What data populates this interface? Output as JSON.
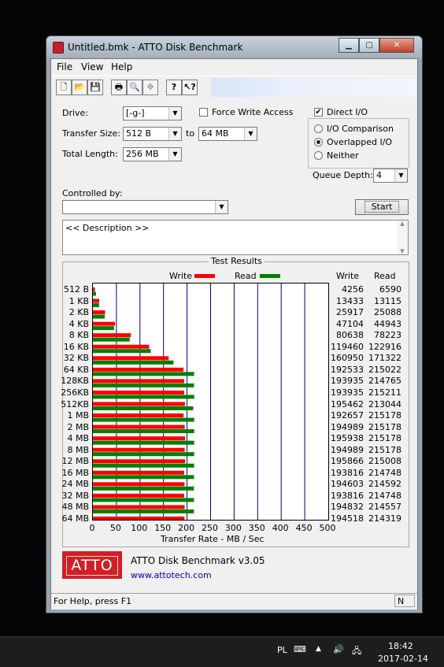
{
  "window": {
    "title": "Untitled.bmk - ATTO Disk Benchmark"
  },
  "menu": {
    "items": [
      "File",
      "View",
      "Help"
    ]
  },
  "toolbar": {
    "icons": [
      "new-icon",
      "open-icon",
      "save-icon",
      "print-icon",
      "print-preview-icon",
      "move-icon",
      "help-icon",
      "context-help-icon"
    ]
  },
  "form": {
    "drive_label": "Drive:",
    "drive_value": "[-g-]",
    "force_write_label": "Force Write Access",
    "force_write_checked": false,
    "direct_io_label": "Direct I/O",
    "direct_io_checked": true,
    "transfer_size_label": "Transfer Size:",
    "transfer_from": "512 B",
    "to_label": "to",
    "transfer_to": "64 MB",
    "total_length_label": "Total Length:",
    "total_length": "256 MB",
    "io_comparison_label": "I/O Comparison",
    "overlapped_io_label": "Overlapped I/O",
    "neither_label": "Neither",
    "selected_mode": "Overlapped I/O",
    "queue_depth_label": "Queue Depth:",
    "queue_depth": "4",
    "controlled_by_label": "Controlled by:",
    "controlled_by_value": "",
    "start_label": "Start",
    "description": "<< Description >>"
  },
  "results": {
    "title": "Test Results",
    "legend_write": "Write",
    "legend_read": "Read",
    "write_header": "Write",
    "read_header": "Read",
    "xlabel": "Transfer Rate - MB / Sec",
    "write_color": "#ff0000",
    "read_color": "#008000"
  },
  "chart_data": {
    "type": "bar",
    "orientation": "horizontal",
    "categories": [
      "512 B",
      "1 KB",
      "2 KB",
      "4 KB",
      "8 KB",
      "16 KB",
      "32 KB",
      "64 KB",
      "128KB",
      "256KB",
      "512KB",
      "1 MB",
      "2 MB",
      "4 MB",
      "8 MB",
      "12 MB",
      "16 MB",
      "24 MB",
      "32 MB",
      "48 MB",
      "64 MB"
    ],
    "series": [
      {
        "name": "Write",
        "values": [
          4256,
          13433,
          25917,
          47104,
          80638,
          119460,
          160950,
          192533,
          193935,
          193935,
          195462,
          192657,
          194989,
          195938,
          194989,
          195866,
          193816,
          194603,
          193816,
          194832,
          194518
        ]
      },
      {
        "name": "Read",
        "values": [
          6590,
          13115,
          25088,
          44943,
          78223,
          122916,
          171322,
          215022,
          214765,
          215211,
          213044,
          215178,
          215178,
          215178,
          215178,
          215008,
          214748,
          214592,
          214748,
          214557,
          214319
        ]
      }
    ],
    "xlabel": "Transfer Rate - MB / Sec",
    "xlim": [
      0,
      500
    ],
    "xticks": [
      0,
      50,
      100,
      150,
      200,
      250,
      300,
      350,
      400,
      450,
      500
    ],
    "grid": true,
    "legend": "top"
  },
  "about": {
    "logo_text": "ATTO",
    "product": "ATTO Disk Benchmark v3.05",
    "link": "www.attotech.com"
  },
  "status": {
    "text": "For Help, press F1",
    "indicator": "N"
  },
  "taskbar": {
    "lang": "PL",
    "time": "18:42",
    "date": "2017-02-14"
  }
}
